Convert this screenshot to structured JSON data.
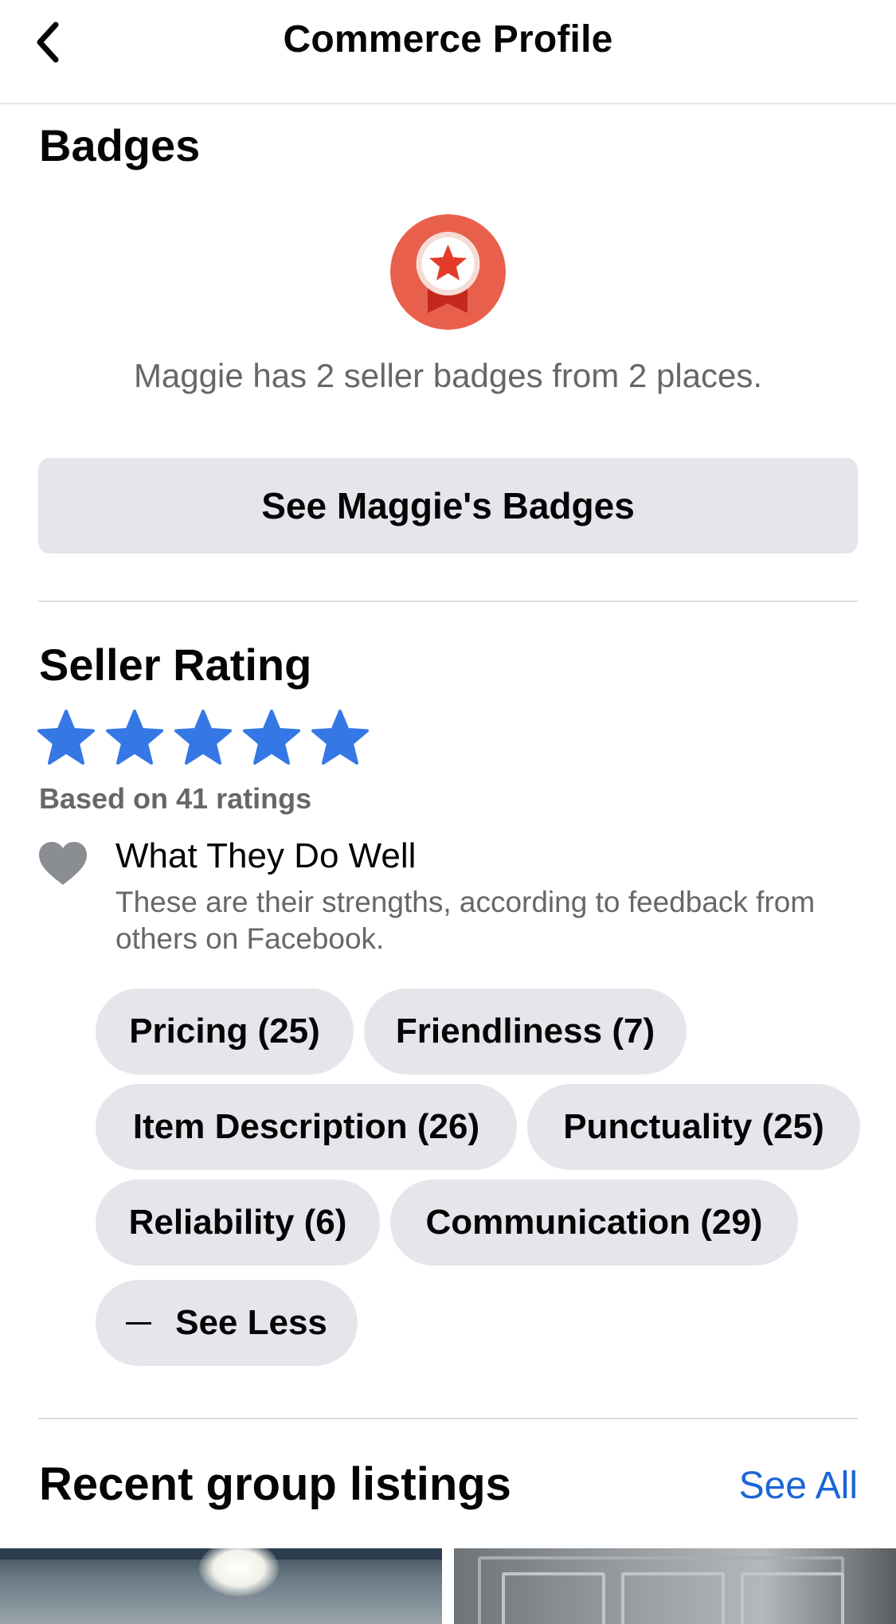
{
  "nav": {
    "title": "Commerce Profile"
  },
  "badges": {
    "title": "Badges",
    "description": "Maggie has 2 seller badges from 2 places.",
    "button_label": "See Maggie's Badges",
    "medal_color": "#e8604c"
  },
  "seller_rating": {
    "title": "Seller Rating",
    "stars": 5,
    "max_stars": 5,
    "star_color": "#3578e5",
    "ratings_count_text": "Based on 41 ratings",
    "strengths": {
      "title": "What They Do Well",
      "description": "These are their strengths, according to feedback from others on Facebook.",
      "icon": "heart-icon",
      "tags": [
        {
          "label": "Pricing (25)"
        },
        {
          "label": "Friendliness (7)"
        },
        {
          "label": "Item Description (26)"
        },
        {
          "label": "Punctuality (25)"
        },
        {
          "label": "Reliability (6)"
        },
        {
          "label": "Communication (29)"
        }
      ],
      "see_less_label": "See Less"
    }
  },
  "recent_listings": {
    "title": "Recent group listings",
    "see_all_label": "See All"
  },
  "colors": {
    "accent": "#1a66d6",
    "pill_bg": "#e4e6eb",
    "secondary_text": "#65676b"
  }
}
